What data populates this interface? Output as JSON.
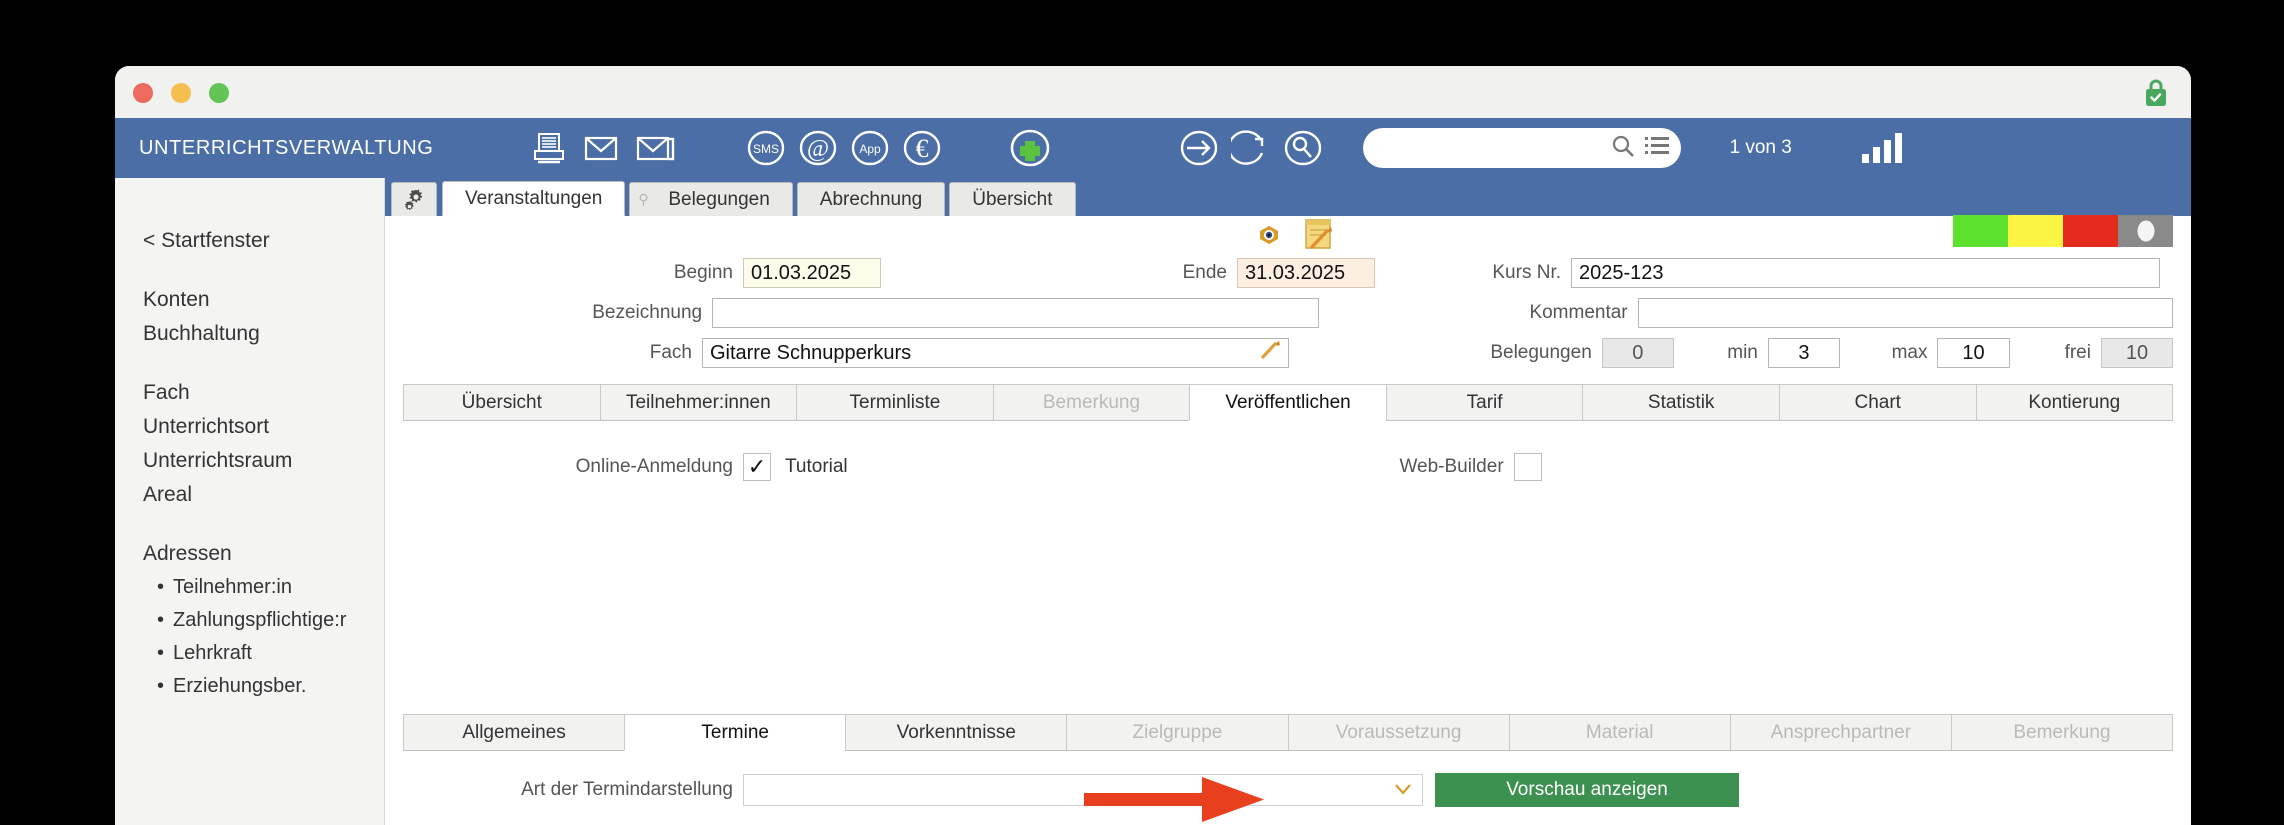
{
  "window": {
    "titlebar": {
      "lock_icon": "lock-secure-icon"
    },
    "traffic_lights": [
      "close",
      "minimize",
      "zoom"
    ]
  },
  "header": {
    "app_title": "UNTERRICHTSVERWALTUNG",
    "icons": [
      "print-icon",
      "mail-icon",
      "mail-multiple-icon",
      "sms-icon",
      "at-sign-icon",
      "app-icon",
      "euro-icon",
      "add-plus-icon",
      "arrow-right-circle-icon",
      "refresh-circle-icon",
      "search-circle-icon"
    ],
    "search": {
      "value": "",
      "placeholder": "",
      "search_icon": "magnifier-icon",
      "list_icon": "list-icon"
    },
    "pager": "1 von 3",
    "signal_icon": "signal-bars-icon"
  },
  "sidebar": {
    "back_link": "< Startfenster",
    "groups": [
      {
        "items": [
          "Konten",
          "Buchhaltung"
        ]
      },
      {
        "items": [
          "Fach",
          "Unterrichtsort",
          "Unterrichtsraum",
          "Areal"
        ]
      },
      {
        "items": [
          "Adressen"
        ],
        "subitems": [
          "Teilnehmer:in",
          "Zahlungspflichtige:r",
          "Lehrkraft",
          "Erziehungsber."
        ]
      }
    ]
  },
  "top_tabs": {
    "gear_icon": "gears-icon",
    "items": [
      {
        "label": "Veranstaltungen",
        "active": true,
        "pin": false
      },
      {
        "label": "Belegungen",
        "active": false,
        "pin": true
      },
      {
        "label": "Abrechnung",
        "active": false,
        "pin": false
      },
      {
        "label": "Übersicht",
        "active": false,
        "pin": false
      }
    ]
  },
  "record_toolbar": {
    "eye_icon": "eye-icon",
    "note_icon": "note-edit-icon",
    "status_colors": [
      "#5ce12f",
      "#fbf442",
      "#e52b1e",
      "#8a8a8a"
    ]
  },
  "form": {
    "beginn_label": "Beginn",
    "beginn_value": "01.03.2025",
    "ende_label": "Ende",
    "ende_value": "31.03.2025",
    "kursnr_label": "Kurs Nr.",
    "kursnr_value": "2025-123",
    "bezeichnung_label": "Bezeichnung",
    "bezeichnung_value": "",
    "kommentar_label": "Kommentar",
    "kommentar_value": "",
    "fach_label": "Fach",
    "fach_value": "Gitarre Schnupperkurs",
    "fach_pencil_icon": "pencil-icon",
    "belegungen_label": "Belegungen",
    "belegungen_value": "0",
    "min_label": "min",
    "min_value": "3",
    "max_label": "max",
    "max_value": "10",
    "frei_label": "frei",
    "frei_value": "10"
  },
  "mid_tabs": [
    {
      "label": "Übersicht",
      "state": "normal"
    },
    {
      "label": "Teilnehmer:innen",
      "state": "normal"
    },
    {
      "label": "Terminliste",
      "state": "normal"
    },
    {
      "label": "Bemerkung",
      "state": "disabled"
    },
    {
      "label": "Veröffentlichen",
      "state": "active"
    },
    {
      "label": "Tarif",
      "state": "normal"
    },
    {
      "label": "Statistik",
      "state": "normal"
    },
    {
      "label": "Chart",
      "state": "normal"
    },
    {
      "label": "Kontierung",
      "state": "normal"
    }
  ],
  "publish_panel": {
    "online_label": "Online-Anmeldung",
    "online_checked": "✓",
    "tutorial_label": "Tutorial",
    "webbuilder_label": "Web-Builder",
    "webbuilder_checked": ""
  },
  "bottom_tabs": [
    {
      "label": "Allgemeines",
      "state": "normal"
    },
    {
      "label": "Termine",
      "state": "active"
    },
    {
      "label": "Vorkenntnisse",
      "state": "normal"
    },
    {
      "label": "Zielgruppe",
      "state": "disabled"
    },
    {
      "label": "Voraussetzung",
      "state": "disabled"
    },
    {
      "label": "Material",
      "state": "disabled"
    },
    {
      "label": "Ansprechpartner",
      "state": "disabled"
    },
    {
      "label": "Bemerkung",
      "state": "disabled"
    }
  ],
  "bottom_row": {
    "art_label": "Art der Termindarstellung",
    "art_value": "",
    "caret_icon": "chevron-down-icon",
    "annotation_arrow": "red-arrow-annotation",
    "preview_button": "Vorschau anzeigen",
    "arrow_color": "#e8401f",
    "button_color": "#3d9150"
  }
}
